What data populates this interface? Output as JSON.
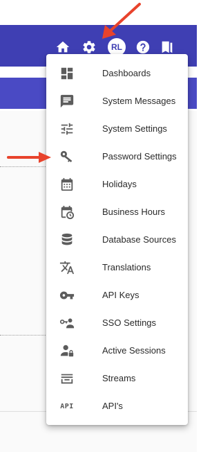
{
  "toolbar": {
    "avatar_initials": "RL",
    "icons": [
      "home-icon",
      "gear-icon",
      "help-icon",
      "bookmark-icon"
    ]
  },
  "menu": {
    "items": [
      {
        "label": "Dashboards",
        "icon": "dashboard-icon"
      },
      {
        "label": "System Messages",
        "icon": "message-icon"
      },
      {
        "label": "System Settings",
        "icon": "tune-icon"
      },
      {
        "label": "Password Settings",
        "icon": "key-icon"
      },
      {
        "label": "Holidays",
        "icon": "calendar-icon"
      },
      {
        "label": "Business Hours",
        "icon": "calendar-clock-icon"
      },
      {
        "label": "Database Sources",
        "icon": "database-icon"
      },
      {
        "label": "Translations",
        "icon": "translate-icon"
      },
      {
        "label": "API Keys",
        "icon": "vpn-key-icon"
      },
      {
        "label": "SSO Settings",
        "icon": "sso-key-person-icon"
      },
      {
        "label": "Active Sessions",
        "icon": "person-lock-icon"
      },
      {
        "label": "Streams",
        "icon": "inbox-stack-icon"
      },
      {
        "label": "API's",
        "icon": "api-text-icon",
        "icon_text": "API"
      }
    ]
  },
  "colors": {
    "toolbar": "#3f3fb3",
    "annotation_arrow": "#e8432c",
    "menu_icon": "#5c5c5c"
  }
}
